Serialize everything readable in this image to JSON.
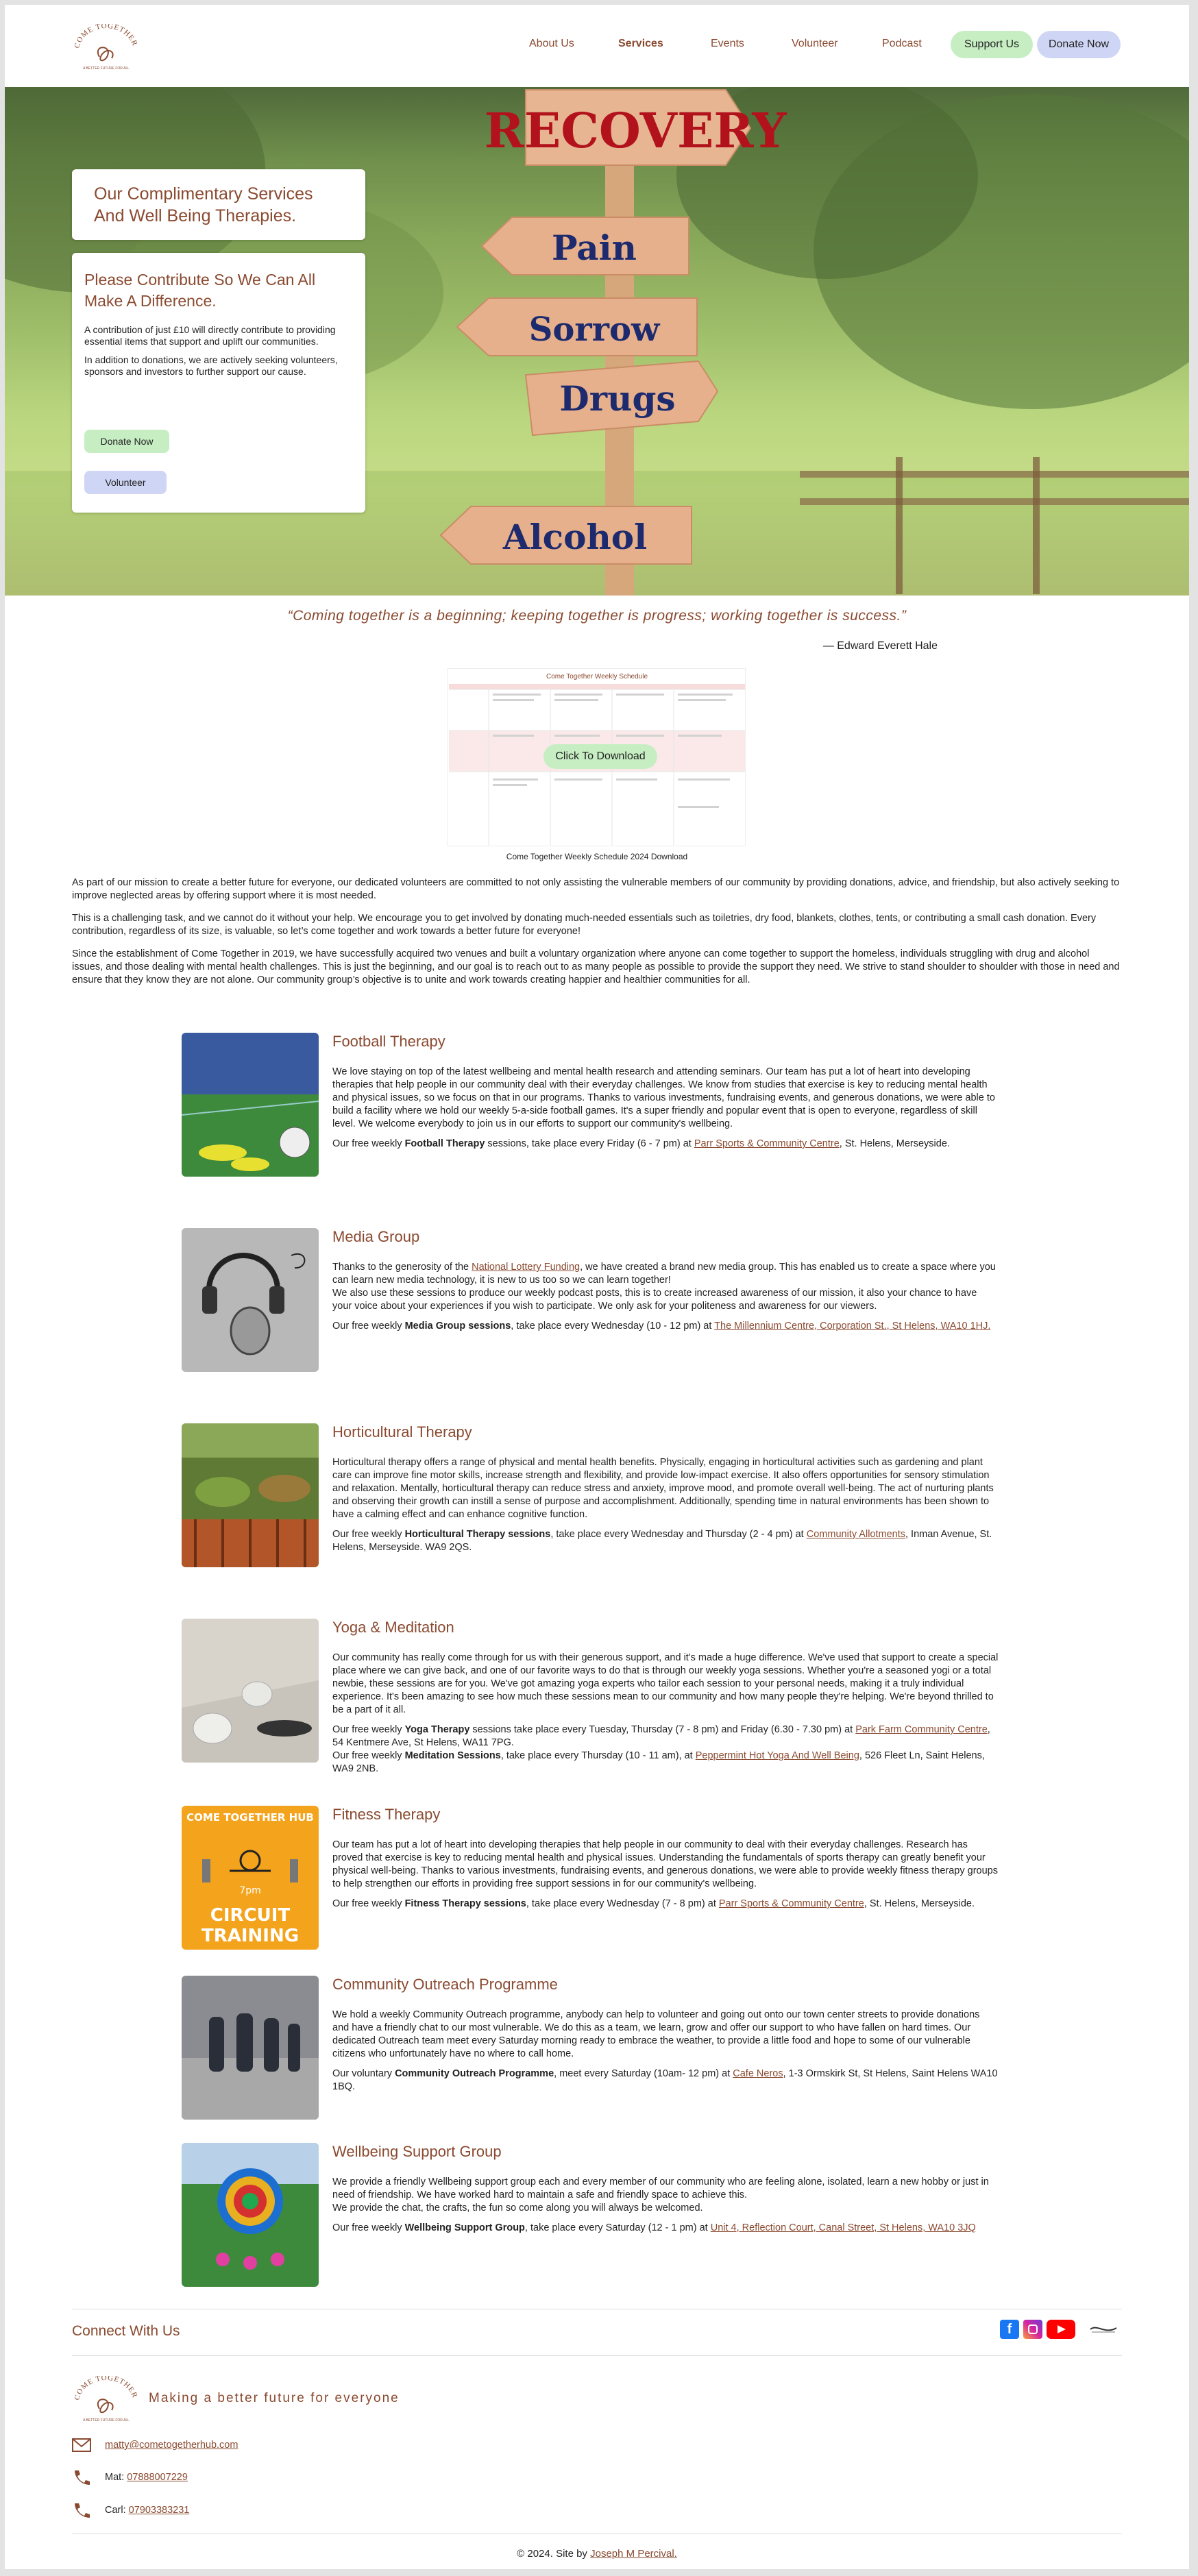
{
  "brand": {
    "accent": "#8a4a30",
    "green_button": "#c7eec3",
    "blue_button": "#cfd5f4",
    "logo_text_top": "COME TOGETHER",
    "logo_text_bottom": "A BETTER FUTURE FOR ALL"
  },
  "nav": {
    "items": [
      "About Us",
      "Services",
      "Events",
      "Volunteer",
      "Podcast"
    ],
    "support_label": "Support Us",
    "donate_label": "Donate Now"
  },
  "hero": {
    "signs": [
      "RECOVERY",
      "Pain",
      "Sorrow",
      "Drugs",
      "Alcohol"
    ],
    "title": "Our Complimentary Services And Well Being Therapies.",
    "contribute_heading": "Please Contribute So We Can All Make A Difference.",
    "contribute_p1": "A contribution of just £10 will directly contribute to providing essential items that support and uplift our communities.",
    "contribute_p2": "In addition to donations, we are actively seeking volunteers, sponsors and investors to further support our cause.",
    "donate_label": "Donate Now",
    "volunteer_label": "Volunteer"
  },
  "quote": {
    "text": "“Coming together is a beginning; keeping together is progress; working together is success.”",
    "author": "— Edward Everett Hale"
  },
  "schedule": {
    "title": "Come Together Weekly Schedule",
    "button": "Click To Download",
    "caption": "Come Together Weekly Schedule 2024 Download"
  },
  "intro": [
    "As part of our mission to create a better future for everyone, our dedicated volunteers are committed to not only assisting the vulnerable members of our community by providing donations, advice, and friendship, but also actively seeking to improve neglected areas by offering support where it is most needed.",
    "This is a challenging task, and we cannot do it without your help. We encourage you to get involved by donating much-needed essentials such as toiletries, dry food, blankets, clothes, tents, or contributing a small cash donation. Every contribution, regardless of its size, is valuable, so let’s come together and work towards a better future for everyone!",
    "Since the establishment of Come Together in 2019, we have successfully acquired two venues and built a voluntary organization where anyone can come together to support the homeless, individuals struggling with drug and alcohol issues, and those dealing with mental health challenges. This is just the beginning, and our goal is to reach out to as many people as possible to provide the support they need. We strive to stand shoulder to shoulder with those in need and ensure that they know they are not alone. Our community group’s objective is to unite and work towards creating happier and healthier communities for all."
  ],
  "services": [
    {
      "title": "Football Therapy",
      "description": "We love staying on top of the latest wellbeing and mental health research and attending seminars. Our team has put a lot of heart into developing therapies that help people in our community deal with their everyday challenges. We know from studies that exercise is key to reducing mental health and physical issues, so we focus on that in our programs. Thanks to various investments, fundraising events, and generous donations, we were able to build a facility where we hold our weekly 5-a-side football games. It's a super friendly and popular event that is open to everyone, regardless of skill level. We welcome everybody to join us in our efforts to support our community's wellbeing.",
      "schedule_pre": "Our free weekly ",
      "schedule_bold": "Football Therapy",
      "schedule_mid": " sessions, take place every Friday (6 - 7 pm) at ",
      "schedule_link": "Parr Sports & Community Centre",
      "schedule_post": ", St. Helens, Merseyside."
    },
    {
      "title": "Media Group",
      "desc_pre": "Thanks to the generosity of the ",
      "desc_link": "National Lottery Funding",
      "desc_post": ", we have created a brand new media group. This has enabled us to create a space where you can learn new media technology, it is new to us too so we can learn together!",
      "description2": "We also use these sessions to produce our weekly podcast posts, this is to create increased awareness of our mission, it also your chance to have your voice about your experiences if you wish to participate. We only ask for your politeness and awareness for our viewers.",
      "schedule_pre": "Our free weekly ",
      "schedule_bold": "Media Group sessions",
      "schedule_mid": ", take place every Wednesday (10 - 12 pm) at ",
      "schedule_link": "The Millennium Centre, Corporation St., St Helens, WA10 1HJ."
    },
    {
      "title": "Horticultural Therapy",
      "description": "Horticultural therapy offers a range of physical and mental health benefits. Physically, engaging in horticultural activities such as gardening and plant care can improve fine motor skills, increase strength and flexibility, and provide low-impact exercise. It also offers opportunities for sensory stimulation and relaxation. Mentally, horticultural therapy can reduce stress and anxiety, improve mood, and promote overall well-being. The act of nurturing plants and observing their growth can instill a sense of purpose and accomplishment. Additionally, spending time in natural environments has been shown to have a calming effect and can enhance cognitive function.",
      "schedule_pre": "Our free weekly ",
      "schedule_bold": "Horticultural Therapy sessions",
      "schedule_mid": ", take place every Wednesday and Thursday (2 - 4 pm) at ",
      "schedule_link": "Community Allotments",
      "schedule_post": ", Inman Avenue, St. Helens, Merseyside. WA9 2QS."
    },
    {
      "title": "Yoga & Meditation",
      "description": "Our community has really come through for us with their generous support, and it's made a huge difference. We've used that support to create a special place where we can give back, and one of our favorite ways to do that is through our weekly yoga sessions. Whether you're a seasoned yogi or a total newbie, these sessions are for you. We've got amazing yoga experts who tailor each session to your personal needs, making it a truly individual experience. It's been amazing to see how much these sessions mean to our community and how many people they're helping. We're beyond thrilled to be a part of it all.",
      "schedule_pre": "Our free weekly ",
      "schedule_bold": "Yoga Therapy",
      "schedule_mid": " sessions take place every Tuesday, Thursday (7 - 8 pm) and Friday (6.30 - 7.30 pm) at ",
      "schedule_link": "Park Farm Community Centre",
      "schedule_post": ", 54 Kentmere Ave, St Helens, WA11 7PG.",
      "schedule2_pre": "Our free weekly ",
      "schedule2_bold": "Meditation Sessions",
      "schedule2_mid": ", take place every Thursday (10 - 11 am), at ",
      "schedule2_link": "Peppermint Hot Yoga And Well Being",
      "schedule2_post": ", 526 Fleet Ln, Saint Helens, WA9 2NB."
    },
    {
      "title": "Fitness Therapy",
      "thumb_top": "COME TOGETHER HUB",
      "thumb_time": "7pm",
      "thumb_bottom1": "CIRCUIT",
      "thumb_bottom2": "TRAINING",
      "description": "Our team has put a lot of heart into developing therapies that help people in our community to deal with their everyday challenges. Research has proved that exercise is key to reducing mental health and physical issues. Understanding the fundamentals of sports therapy can greatly benefit your physical well-being. Thanks to various investments, fundraising events, and generous donations, we were able to provide weekly fitness therapy groups to help strengthen our efforts in providing free support sessions in for our community's wellbeing.",
      "schedule_pre": "Our free weekly ",
      "schedule_bold": "Fitness Therapy sessions",
      "schedule_mid": ", take place every Wednesday (7 - 8 pm) at ",
      "schedule_link": "Parr Sports & Community Centre",
      "schedule_post": ", St. Helens, Merseyside."
    },
    {
      "title": "Community Outreach Programme",
      "description": "We hold a weekly Community Outreach programme, anybody can help to volunteer and going out onto our town center streets to provide donations and have a friendly chat to our most vulnerable.  We do this as a team, we learn, grow and offer our support to who have fallen on hard times. Our dedicated Outreach team meet every Saturday morning ready to embrace the weather, to provide a little food and hope to some of our vulnerable citizens who unfortunately have no where to call home.",
      "schedule_pre": "Our voluntary ",
      "schedule_bold": "Community Outreach Programme",
      "schedule_mid": ", meet every Saturday (10am- 12 pm) at ",
      "schedule_link": "Cafe Neros",
      "schedule_post": ", 1-3 Ormskirk St, St Helens, Saint Helens WA10 1BQ."
    },
    {
      "title": "Wellbeing Support Group",
      "description": "We provide a friendly Wellbeing support group each and every member of our community who are feeling alone, isolated, learn a new hobby or just in need of friendship. We have worked hard to maintain a safe and friendly space to achieve this.",
      "description2": "We provide the chat, the crafts, the fun so come along you will always be welcomed.",
      "schedule_pre": "Our free weekly ",
      "schedule_bold": "Wellbeing Support Group",
      "schedule_mid": ", take place every Saturday (12 - 1 pm) at ",
      "schedule_link": "Unit 4, Reflection Court, Canal Street, St Helens, WA10 3JQ"
    }
  ],
  "footer": {
    "connect": "Connect With Us",
    "social": [
      "facebook-icon",
      "instagram-icon",
      "youtube-icon",
      "partner-logo-icon"
    ],
    "tagline": "Making a better future for everyone",
    "email": "matty@cometogetherhub.com",
    "mat_label": "Mat: ",
    "mat_phone": "07888007229",
    "carl_label": "Carl: ",
    "carl_phone": "07903383231",
    "copyright_pre": "© 2024. Site by ",
    "copyright_link": "Joseph M Percival."
  }
}
